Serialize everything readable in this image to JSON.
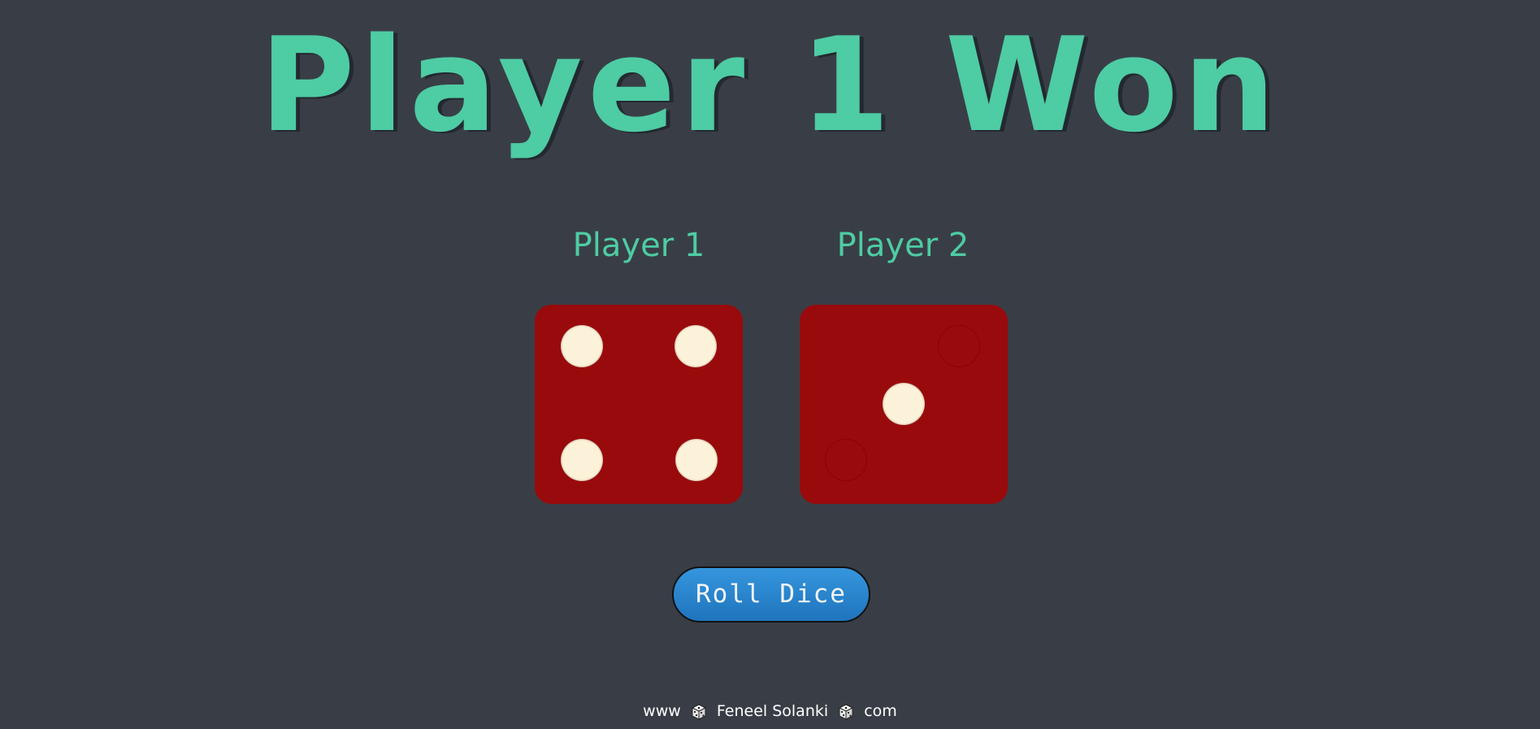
{
  "title": "Player 1 Won",
  "players": [
    {
      "label": "Player 1",
      "die_value": 4
    },
    {
      "label": "Player 2",
      "die_value": 2
    }
  ],
  "roll_button": {
    "label": "Roll Dice"
  },
  "footer": {
    "prefix": "www",
    "name": "Feneel Solanki",
    "suffix": "com",
    "separator_icon": "dice-icon"
  },
  "colors": {
    "background": "#393e46",
    "accent": "#4ecca3",
    "die": "#990a0c",
    "pip": "#fcf1d9",
    "button": "#2a85cf"
  }
}
